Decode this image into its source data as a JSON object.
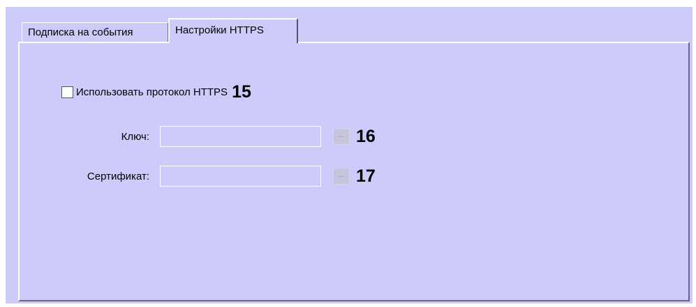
{
  "tabs": [
    {
      "label": "Подписка на события",
      "active": false
    },
    {
      "label": "Настройки HTTPS",
      "active": true
    }
  ],
  "https": {
    "checkbox_label": "Использовать протокол HTTPS",
    "checkbox_checked": false,
    "callout": "15"
  },
  "fields": {
    "key": {
      "label": "Ключ:",
      "value": "",
      "browse_label": "...",
      "callout": "16"
    },
    "certificate": {
      "label": "Сертификат:",
      "value": "",
      "browse_label": "...",
      "callout": "17"
    }
  },
  "colors": {
    "panel_background": "#cccbf9",
    "page_background": "#ffffff"
  }
}
